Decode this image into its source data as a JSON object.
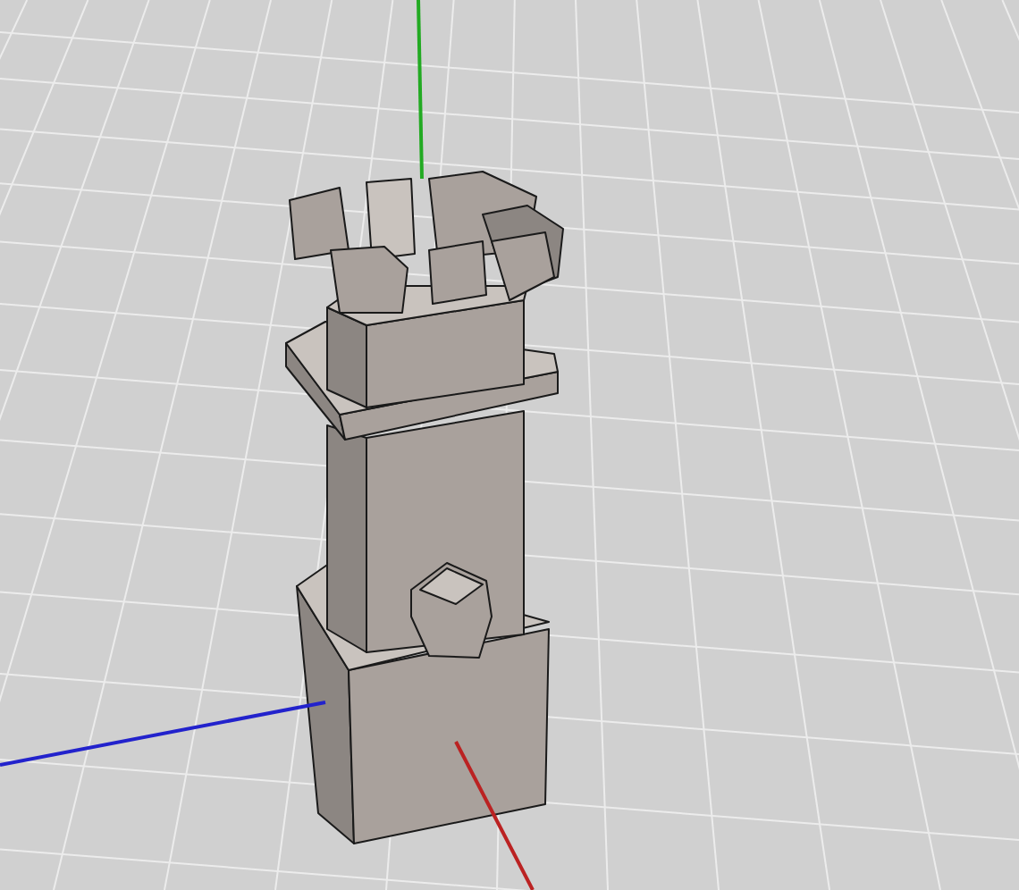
{
  "viewport": {
    "axes": [
      {
        "kind": "y",
        "color": "#22aa22"
      },
      {
        "kind": "x",
        "color": "#2222cc"
      },
      {
        "kind": "z",
        "color": "#bb2222"
      }
    ]
  }
}
